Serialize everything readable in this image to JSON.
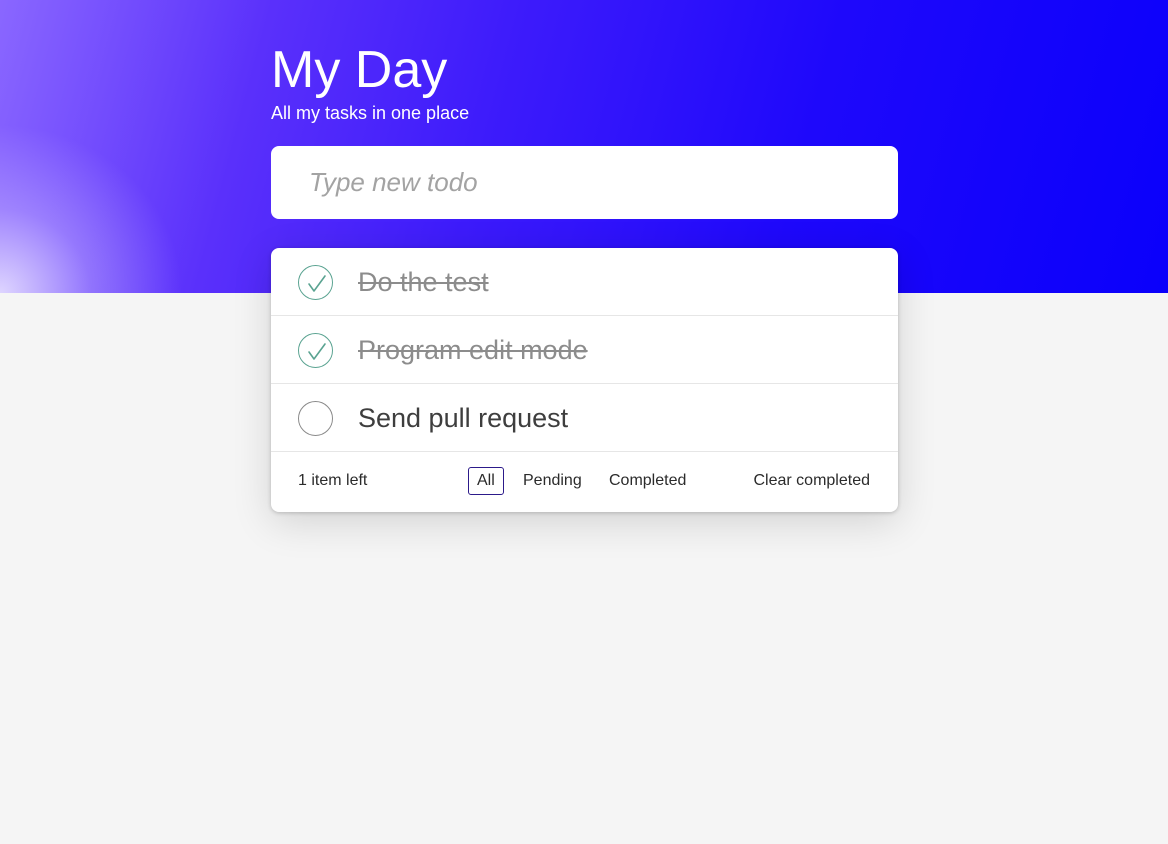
{
  "header": {
    "title": "My Day",
    "subtitle": "All my tasks in one place"
  },
  "new_todo": {
    "value": "",
    "placeholder": "Type new todo"
  },
  "todos": [
    {
      "text": "Do the test",
      "completed": true
    },
    {
      "text": "Program edit mode",
      "completed": true
    },
    {
      "text": "Send pull request",
      "completed": false
    }
  ],
  "footer": {
    "items_left": "1 item left",
    "filters": [
      {
        "label": "All",
        "active": true
      },
      {
        "label": "Pending",
        "active": false
      },
      {
        "label": "Completed",
        "active": false
      }
    ],
    "clear_label": "Clear completed"
  },
  "icons": {
    "completed": "check-circle-icon",
    "pending": "empty-circle-icon"
  },
  "colors": {
    "accent_check": "#5aa391",
    "gradient_start": "#8a67ff",
    "gradient_end": "#0a00fb",
    "active_filter_border": "#2c1a8a"
  }
}
